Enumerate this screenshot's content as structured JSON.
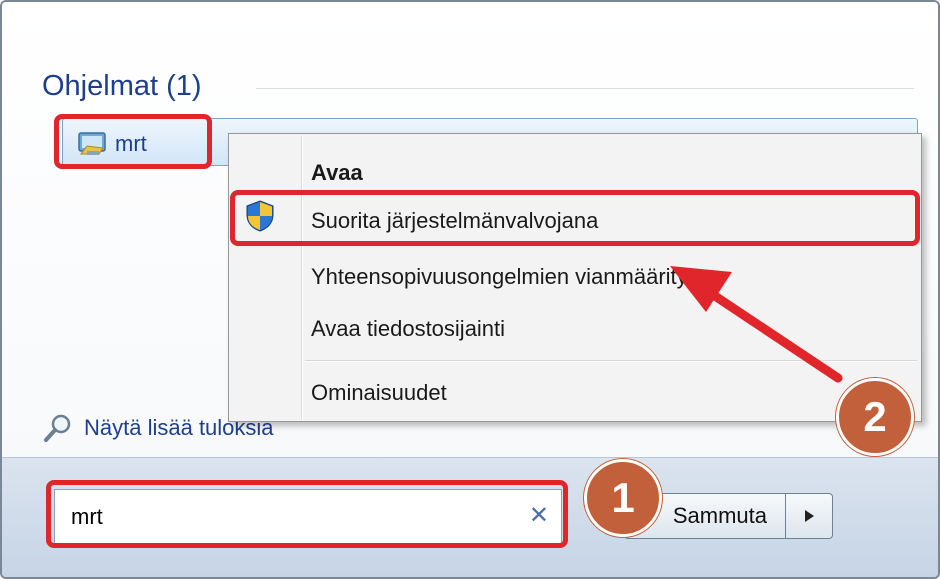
{
  "programs": {
    "header": "Ohjelmat (1)",
    "items": [
      {
        "label": "mrt",
        "icon": "mrt-program-icon"
      }
    ]
  },
  "context_menu": {
    "items": [
      {
        "label": "Avaa",
        "bold": true
      },
      {
        "label": "Suorita järjestelmänvalvojana",
        "icon": "uac-shield-icon"
      },
      {
        "label": "Yhteensopivuusongelmien vianmääritys"
      },
      {
        "label": "Avaa tiedostosijainti"
      },
      {
        "label": "Ominaisuudet"
      }
    ]
  },
  "more_results": {
    "label": "Näytä lisää tuloksia",
    "icon": "magnifier-icon"
  },
  "search": {
    "value": "mrt",
    "clear_icon": "✕"
  },
  "shutdown": {
    "label": "Sammuta",
    "arrow_icon": "triangle-right-icon"
  },
  "annotations": {
    "badge_1": "1",
    "badge_2": "2",
    "highlight_color": "#e0252b",
    "badge_color": "#c2603b"
  }
}
